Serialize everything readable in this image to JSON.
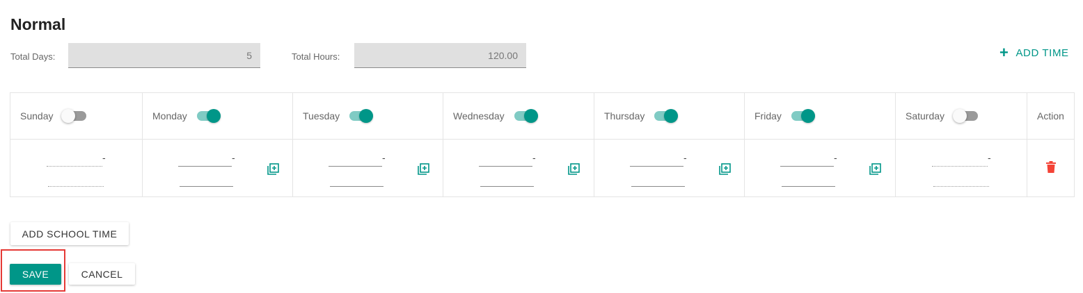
{
  "section": {
    "title": "Normal"
  },
  "summary": {
    "total_days_label": "Total Days:",
    "total_days_value": "5",
    "total_hours_label": "Total Hours:",
    "total_hours_value": "120.00"
  },
  "add_time": {
    "icon": "plus-icon",
    "label": "ADD TIME"
  },
  "schedule": {
    "days": [
      {
        "name": "Sunday",
        "enabled": false
      },
      {
        "name": "Monday",
        "enabled": true
      },
      {
        "name": "Tuesday",
        "enabled": true
      },
      {
        "name": "Wednesday",
        "enabled": true
      },
      {
        "name": "Thursday",
        "enabled": true
      },
      {
        "name": "Friday",
        "enabled": true
      },
      {
        "name": "Saturday",
        "enabled": false
      }
    ],
    "action_header": "Action",
    "time_separator": "-"
  },
  "buttons": {
    "add_school_time": "ADD SCHOOL TIME",
    "save": "SAVE",
    "cancel": "CANCEL"
  },
  "colors": {
    "accent": "#009688",
    "toggle_track_on": "#80cbc4",
    "delete": "#f44336",
    "highlight": "#e53935"
  }
}
